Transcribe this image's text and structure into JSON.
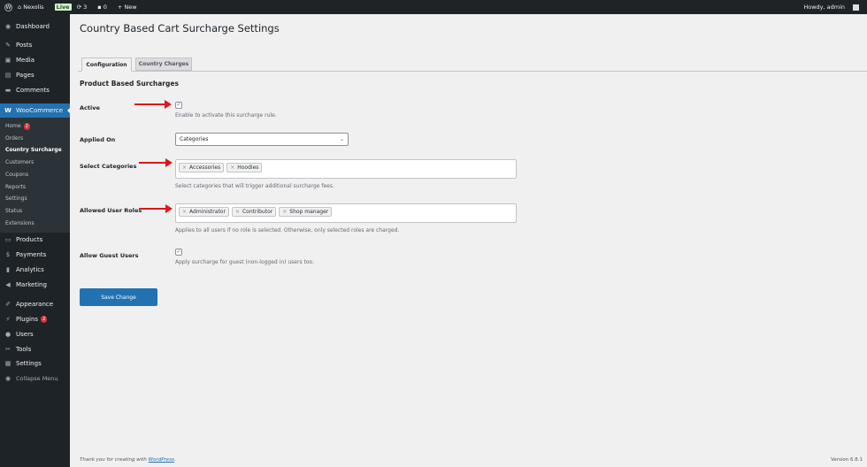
{
  "adminbar": {
    "site": "Nexolis",
    "live": "Live",
    "updates": "3",
    "comments": "0",
    "new": "+ New",
    "howdy": "Howdy, admin"
  },
  "sidebar": {
    "items": [
      "Dashboard",
      "Posts",
      "Media",
      "Pages",
      "Comments",
      "WooCommerce",
      "Products",
      "Payments",
      "Analytics",
      "Marketing",
      "Appearance",
      "Plugins",
      "Users",
      "Tools",
      "Settings",
      "Collapse Menu"
    ],
    "submenu": [
      "Home",
      "Orders",
      "Country Surcharge",
      "Customers",
      "Coupons",
      "Reports",
      "Settings",
      "Status",
      "Extensions"
    ],
    "home_badge": "2",
    "plugins_badge": "2"
  },
  "page": {
    "title": "Country Based Cart Surcharge Settings",
    "tabs": [
      "Configuration",
      "Country Charges"
    ],
    "section": "Product Based Surcharges"
  },
  "form": {
    "active": {
      "label": "Active",
      "checked": true,
      "desc": "Enable to activate this surcharge rule."
    },
    "applied_on": {
      "label": "Applied On",
      "value": "Categories"
    },
    "categories": {
      "label": "Select Categories",
      "tags": [
        "Accessories",
        "Hoodies"
      ],
      "desc": "Select categories that will trigger additional surcharge fees."
    },
    "roles": {
      "label": "Allowed User Roles",
      "tags": [
        "Administrator",
        "Contributor",
        "Shop manager"
      ],
      "desc": "Applies to all users if no role is selected. Otherwise, only selected roles are charged."
    },
    "guest": {
      "label": "Allow Guest Users",
      "checked": true,
      "desc": "Apply surcharge for guest (non-logged in) users too."
    },
    "save": "Save Change"
  },
  "footer": {
    "thanks": "Thank you for creating with",
    "link": "WordPress",
    "version": "Version 6.8.1"
  }
}
